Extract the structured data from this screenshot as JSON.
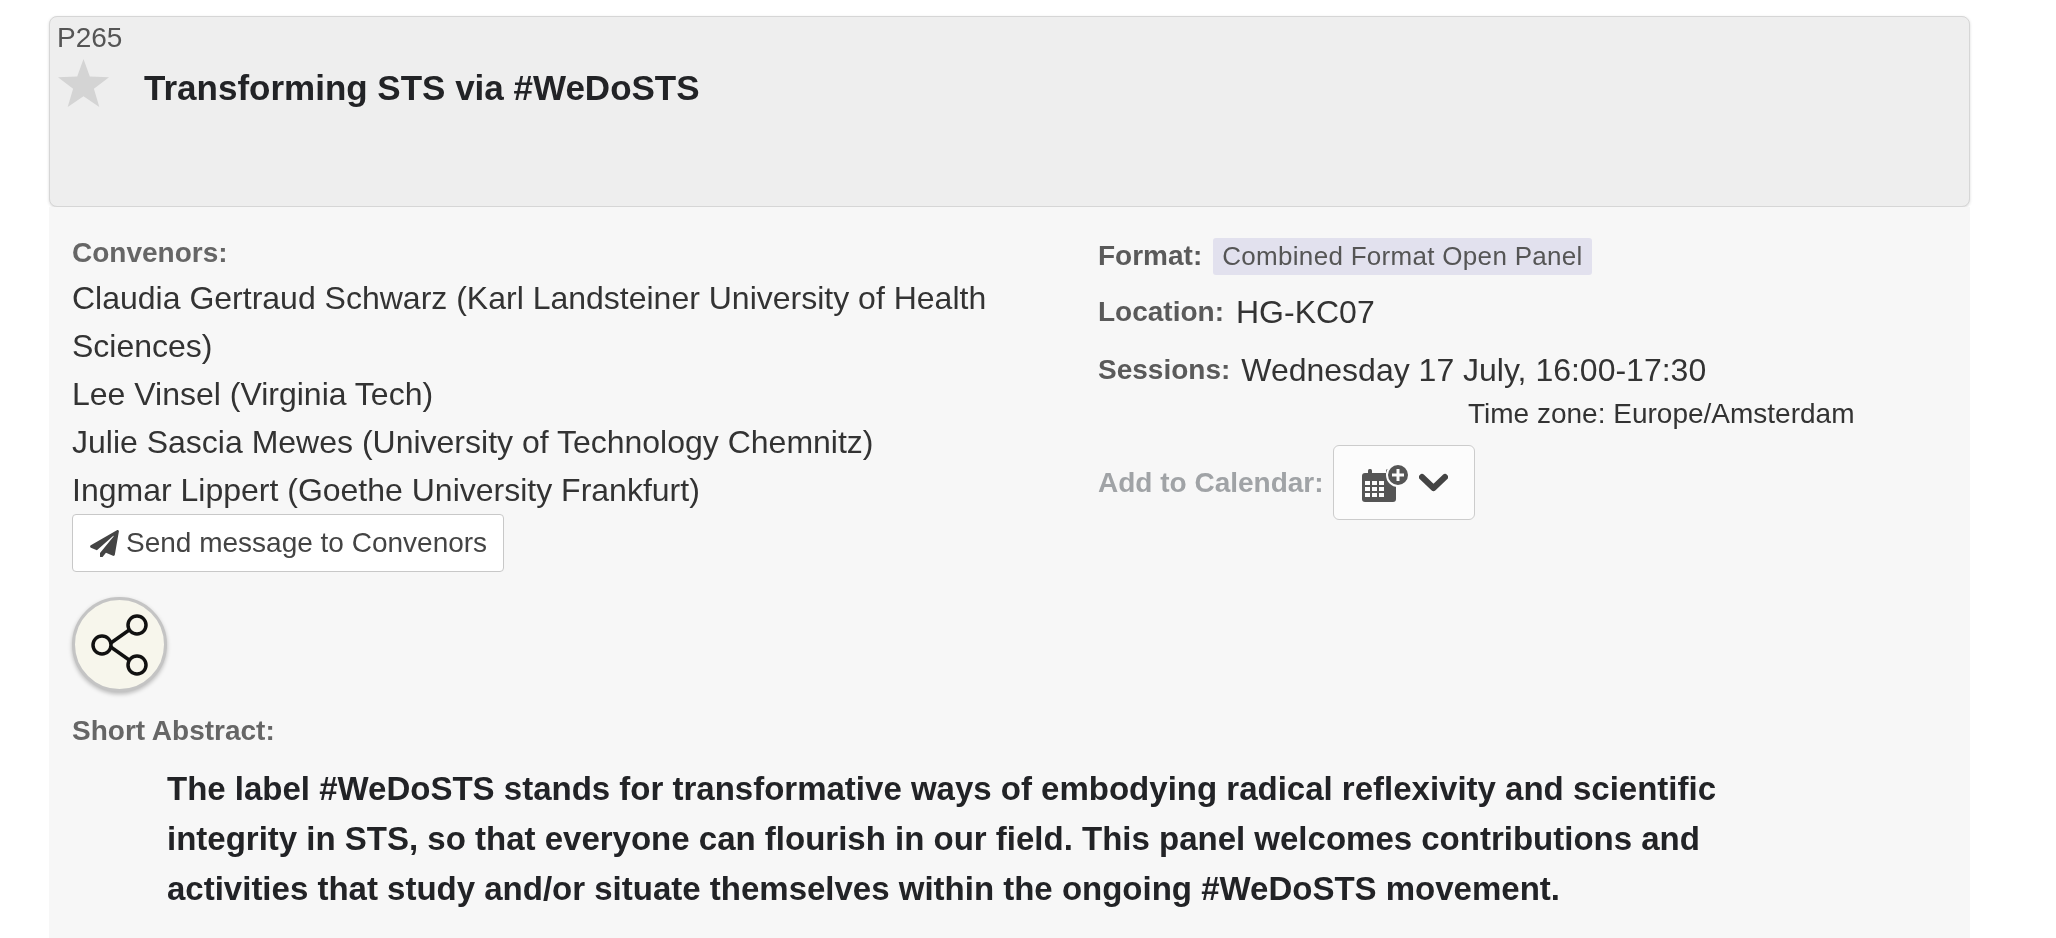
{
  "panel": {
    "code": "P265",
    "starred": false,
    "title": "Transforming STS via #WeDoSTS"
  },
  "convenors": {
    "label": "Convenors:",
    "names": [
      "Claudia Gertraud Schwarz (Karl Landsteiner University of Health Sciences)",
      "Lee Vinsel (Virginia Tech)",
      "Julie Sascia Mewes (University of Technology Chemnitz)",
      "Ingmar Lippert (Goethe University Frankfurt)"
    ],
    "message_button": "Send message to Convenors"
  },
  "details": {
    "format": {
      "label": "Format:",
      "value": "Combined Format Open Panel"
    },
    "location": {
      "label": "Location:",
      "value": "HG-KC07"
    },
    "sessions": {
      "label": "Sessions:",
      "value": "Wednesday 17 July, 16:00-17:30",
      "time_zone": "Time zone: Europe/Amsterdam"
    },
    "calendar": {
      "label": "Add to Calendar:"
    }
  },
  "abstract": {
    "label": "Short Abstract:",
    "text": "The label #WeDoSTS stands for transformative ways of embodying radical reflexivity and scientific integrity in STS, so that everyone can flourish in our field. This panel welcomes contributions and activities that study and/or situate themselves within the ongoing #WeDoSTS movement."
  }
}
